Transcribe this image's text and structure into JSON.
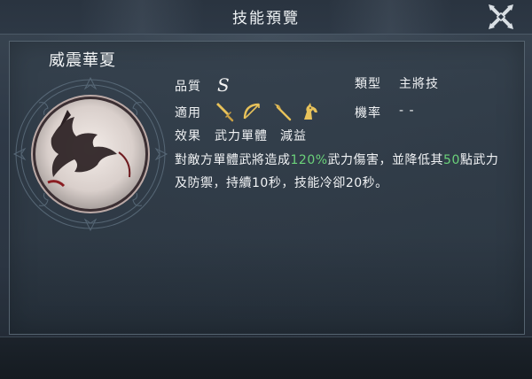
{
  "header": {
    "title": "技能預覽"
  },
  "skill": {
    "name": "威震華夏",
    "quality_label": "品質",
    "quality_value": "S",
    "type_label": "類型",
    "type_value": "主將技",
    "applies_label": "適用",
    "applies_icons": [
      "sword-icon",
      "bow-icon",
      "spear-icon",
      "horse-icon"
    ],
    "chance_label": "機率",
    "chance_value": "- -",
    "effect_label": "效果",
    "effect_tags": [
      "武力單體",
      "減益"
    ],
    "description": {
      "part1": "對敵方單體武將造成",
      "pct": "120%",
      "part2": "武力傷害，並降低其",
      "num": "50",
      "part3": "點武力及防禦，持續10秒，技能冷卻20秒。"
    }
  },
  "colors": {
    "highlight": "#6bd27a",
    "icon_gold": "#e8c25a",
    "background": "#2a3340"
  }
}
